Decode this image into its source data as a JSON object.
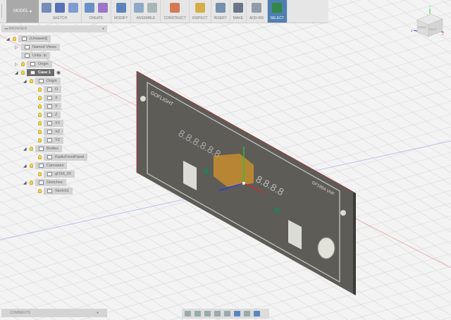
{
  "toolbar": {
    "workspace": "MODEL",
    "groups": [
      {
        "id": "sketch",
        "label": "SKETCH"
      },
      {
        "id": "create",
        "label": "CREATE"
      },
      {
        "id": "modify",
        "label": "MODIFY"
      },
      {
        "id": "assemble",
        "label": "ASSEMBLE"
      },
      {
        "id": "construct",
        "label": "CONSTRUCT"
      },
      {
        "id": "inspect",
        "label": "INSPECT"
      },
      {
        "id": "insert",
        "label": "INSERT"
      },
      {
        "id": "make",
        "label": "MAKE"
      },
      {
        "id": "addins",
        "label": "ADD-INS"
      },
      {
        "id": "select",
        "label": "SELECT"
      }
    ]
  },
  "browser": {
    "title": "BROWSER",
    "items": [
      {
        "label": "(Unsaved)",
        "level": 0,
        "expand": "open"
      },
      {
        "label": "Named Views",
        "level": 1,
        "expand": "closed",
        "nobulb": true
      },
      {
        "label": "Units: in",
        "level": 1,
        "nobulb": true
      },
      {
        "label": "Origin",
        "level": 1,
        "expand": "closed"
      },
      {
        "label": "Case:1",
        "level": 1,
        "expand": "open",
        "active": true
      },
      {
        "label": "Origin",
        "level": 2,
        "expand": "open"
      },
      {
        "label": "O",
        "level": 3
      },
      {
        "label": "X",
        "level": 3
      },
      {
        "label": "Y",
        "level": 3
      },
      {
        "label": "Z",
        "level": 3
      },
      {
        "label": "XY",
        "level": 3
      },
      {
        "label": "XZ",
        "level": 3
      },
      {
        "label": "YZ",
        "level": 3
      },
      {
        "label": "Bodies",
        "level": 2,
        "expand": "open"
      },
      {
        "label": "RadioFrontPanel",
        "level": 3
      },
      {
        "label": "Canvases",
        "level": 2,
        "expand": "open"
      },
      {
        "label": "gf166_03",
        "level": 3
      },
      {
        "label": "Sketches",
        "level": 2,
        "expand": "open"
      },
      {
        "label": "Sketch1",
        "level": 3
      }
    ]
  },
  "comments": {
    "title": "COMMENTS"
  },
  "viewcube": {
    "face_front": "FRONT",
    "face_right": "RIGHT",
    "axis_x": "X",
    "axis_y": "Y",
    "axis_z": "Z"
  },
  "panel": {
    "brand": "GOFLIGHT",
    "model": "GF166A VHF",
    "display1": "8.8.8.8.8.8",
    "display2": "8.8.8.8"
  }
}
